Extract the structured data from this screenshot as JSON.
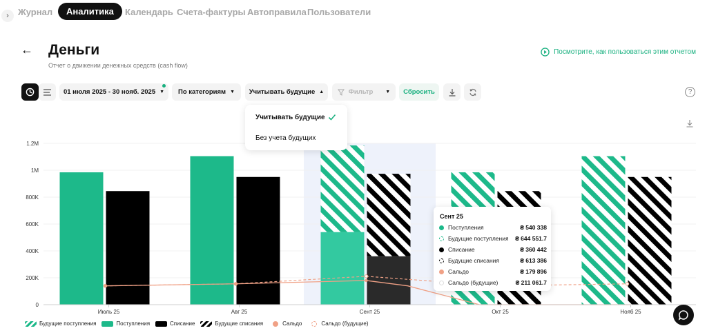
{
  "nav": {
    "tabs": [
      {
        "label": "Журнал"
      },
      {
        "label": "Аналитика"
      },
      {
        "label": "Календарь"
      },
      {
        "label": "Счета-фактуры"
      },
      {
        "label": "Автоправила"
      },
      {
        "label": "Пользователи"
      }
    ],
    "active_tab": "Аналитика"
  },
  "page": {
    "title": "Деньги",
    "subtitle": "Отчет о движении денежных средств (cash flow)",
    "help_link": "Посмотрите, как пользоваться этим отчетом"
  },
  "toolbar": {
    "date_range": "01 июля 2025 - 30 нояб. 2025",
    "group_by": "По категориям",
    "future_mode": "Учитывать будущие",
    "filter_label": "Фильтр",
    "reset_label": "Сбросить"
  },
  "dropdown": {
    "options": [
      {
        "label": "Учитывать будущие",
        "selected": true
      },
      {
        "label": "Без учета будущих",
        "selected": false
      }
    ]
  },
  "tooltip": {
    "title": "Сент 25",
    "rows": [
      {
        "label": "Поступления",
        "value": "₴ 540 338"
      },
      {
        "label": "Будущие поступления",
        "value": "₴ 644 551.7"
      },
      {
        "label": "Списание",
        "value": "₴ 360 442"
      },
      {
        "label": "Будущие списания",
        "value": "₴ 613 386"
      },
      {
        "label": "Сальдо",
        "value": "₴ 179 896"
      },
      {
        "label": "Сальдо (будущие)",
        "value": "₴ 211 061.7"
      }
    ]
  },
  "legend": [
    {
      "label": "Будущие поступления"
    },
    {
      "label": "Поступления"
    },
    {
      "label": "Списание"
    },
    {
      "label": "Будущие списания"
    },
    {
      "label": "Сальдо"
    },
    {
      "label": "Сальдо (будущие)"
    }
  ],
  "colors": {
    "income": "#1db98a",
    "income_highlight": "#33c9a0",
    "expense": "#000000",
    "expense_highlight": "#2a2a2a",
    "saldo": "#f0a186",
    "accent": "#18b07f",
    "highlight_bg": "#eef2fb"
  },
  "chart_data": {
    "type": "bar",
    "categories": [
      "Июль 25",
      "Авг 25",
      "Сент 25",
      "Окт 25",
      "Нояб 25"
    ],
    "ylim": [
      0,
      1200000
    ],
    "yticks": [
      {
        "value": 0,
        "label": "0"
      },
      {
        "value": 200000,
        "label": "200K"
      },
      {
        "value": 400000,
        "label": "400K"
      },
      {
        "value": 600000,
        "label": "600K"
      },
      {
        "value": 800000,
        "label": "800K"
      },
      {
        "value": 1000000,
        "label": "1M"
      },
      {
        "value": 1200000,
        "label": "1.2M"
      }
    ],
    "highlighted_category": "Сент 25",
    "series": [
      {
        "name": "Поступления",
        "values": [
          985000,
          1105000,
          540338,
          0,
          0
        ]
      },
      {
        "name": "Будущие поступления",
        "values": [
          0,
          0,
          644551.7,
          985000,
          1105000
        ]
      },
      {
        "name": "Списание",
        "values": [
          845000,
          950000,
          360442,
          0,
          0
        ]
      },
      {
        "name": "Будущие списания",
        "values": [
          0,
          0,
          613386,
          845000,
          950000
        ]
      },
      {
        "name": "Сальдо",
        "values": [
          140000,
          155000,
          179896,
          0,
          0
        ]
      },
      {
        "name": "Сальдо (будущие)",
        "values": [
          140000,
          155000,
          211061.7,
          140000,
          155000
        ]
      }
    ]
  }
}
